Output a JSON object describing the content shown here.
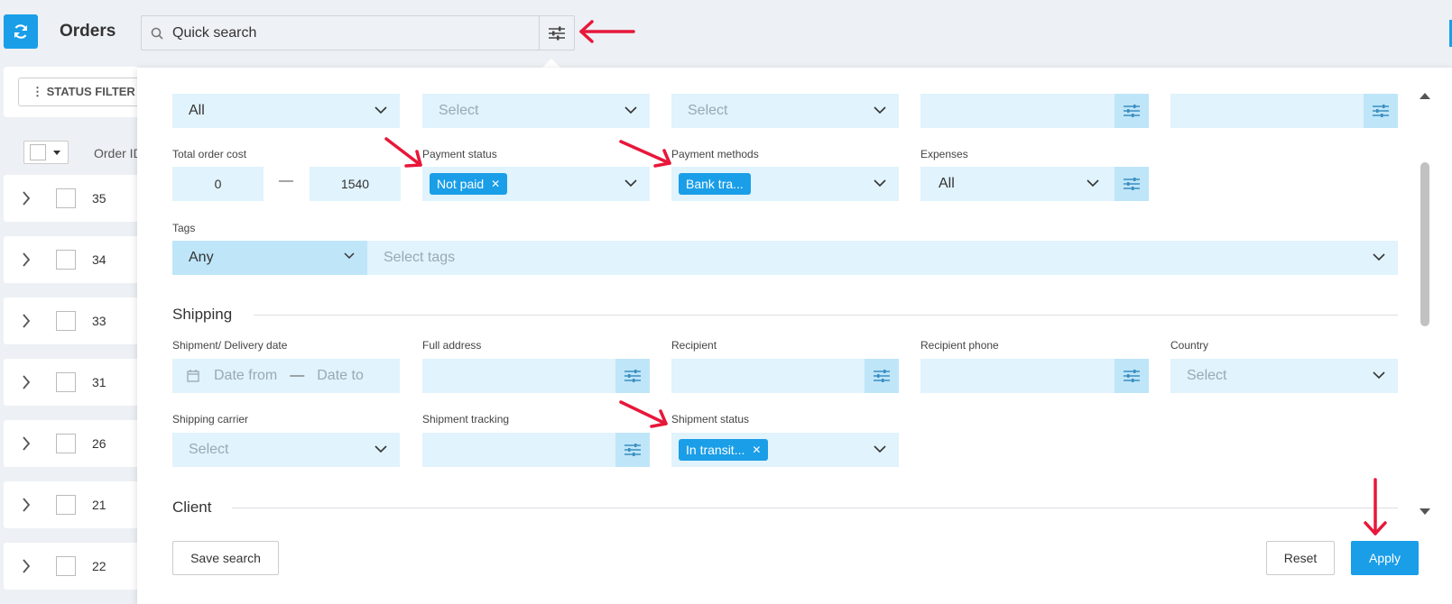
{
  "app": {
    "title": "Orders"
  },
  "search": {
    "placeholder": "Quick search"
  },
  "list": {
    "status_filter_label": "⋮ STATUS FILTER",
    "col_order_id": "Order ID",
    "rows": [
      "35",
      "34",
      "33",
      "31",
      "26",
      "21",
      "22"
    ]
  },
  "filters": {
    "row1": {
      "all_value": "All",
      "select_a": "Select",
      "select_b": "Select"
    },
    "total_order_cost": {
      "label": "Total order cost",
      "min": "0",
      "max": "1540"
    },
    "payment_status": {
      "label": "Payment status",
      "tag": "Not paid"
    },
    "payment_methods": {
      "label": "Payment methods",
      "tag": "Bank tra..."
    },
    "expenses": {
      "label": "Expenses",
      "value": "All"
    },
    "tags": {
      "label": "Tags",
      "mode": "Any",
      "placeholder": "Select tags"
    }
  },
  "shipping": {
    "title": "Shipping",
    "delivery_date": {
      "label": "Shipment/ Delivery date",
      "from": "Date from",
      "to": "Date to"
    },
    "full_address": {
      "label": "Full address"
    },
    "recipient": {
      "label": "Recipient"
    },
    "recipient_phone": {
      "label": "Recipient phone"
    },
    "country": {
      "label": "Country",
      "placeholder": "Select"
    },
    "carrier": {
      "label": "Shipping carrier",
      "placeholder": "Select"
    },
    "tracking": {
      "label": "Shipment tracking"
    },
    "status": {
      "label": "Shipment status",
      "tag": "In transit..."
    }
  },
  "client": {
    "title": "Client"
  },
  "actions": {
    "save": "Save search",
    "reset": "Reset",
    "apply": "Apply"
  },
  "colors": {
    "accent": "#1a9ee8",
    "field_bg": "#e1f3fc",
    "annotation": "#e8173a"
  }
}
